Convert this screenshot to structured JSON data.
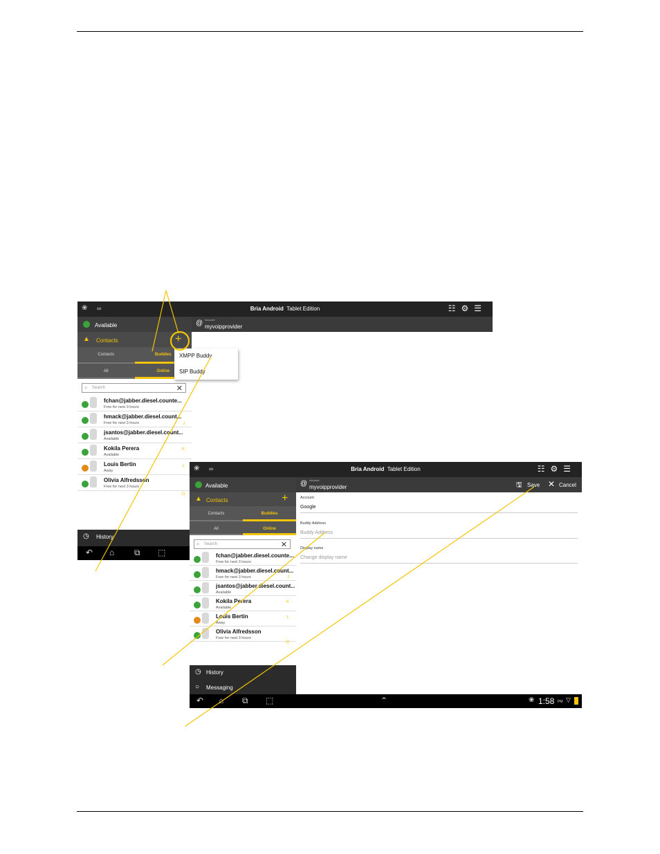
{
  "app": {
    "name": "Bria Android",
    "edition": "Tablet Edition",
    "presence": "Available",
    "contacts_label": "Contacts",
    "account_small": "Account",
    "account_name": "myvoipprovider",
    "tabs_top": [
      "Contacts",
      "Buddies"
    ],
    "tabs_bottom": [
      "All",
      "Online"
    ],
    "search_placeholder": "Search",
    "history": "History",
    "messaging": "Messaging"
  },
  "buddies": [
    {
      "name": "fchan@jabber.diesel.counte...",
      "status": "Free for next 3 hours",
      "state": "available"
    },
    {
      "name": "hmack@jabber.diesel.count...",
      "status": "Free for next 3 hours",
      "state": "available"
    },
    {
      "name": "jsantos@jabber.diesel.count...",
      "status": "Available",
      "state": "available"
    },
    {
      "name": "Kokila Perera",
      "status": "Available",
      "state": "available"
    },
    {
      "name": "Louis Bertin",
      "status": "Away",
      "state": "away"
    },
    {
      "name": "Olivia Alfredsson",
      "status": "Free for next 3 hours",
      "state": "available"
    }
  ],
  "letters": [
    "J",
    "K",
    "L",
    "O"
  ],
  "menu": {
    "xmpp": "XMPP Buddy",
    "sip": "SIP Buddy"
  },
  "form": {
    "save": "Save",
    "cancel": "Cancel",
    "account_label": "Account",
    "account_value": "Google",
    "buddy_label": "Buddy Address",
    "buddy_placeholder": "Buddy Address",
    "display_label": "Display name",
    "display_placeholder": "Change display name"
  },
  "status_bar": {
    "time": "1:58",
    "ampm": "PM"
  },
  "colors": {
    "accent": "#f2c40a",
    "available": "#3aa33a",
    "away": "#e48a1b",
    "callout": "#f5c400"
  }
}
